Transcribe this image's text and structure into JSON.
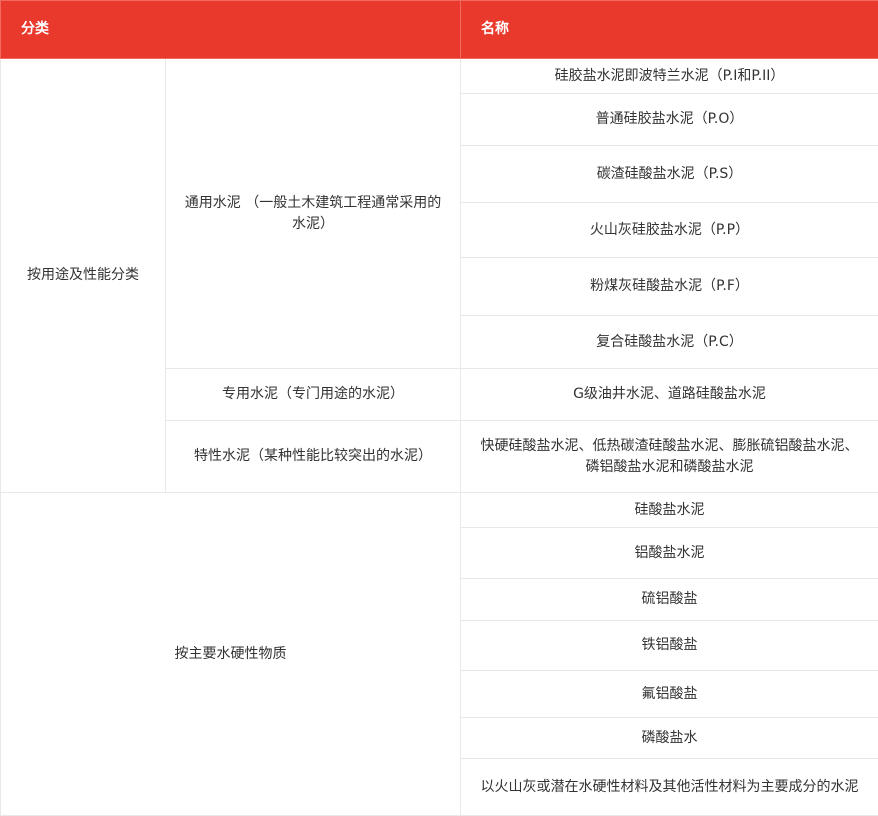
{
  "header": {
    "col1": "分类",
    "col2": "名称"
  },
  "group1": {
    "label": "按用途及性能分类",
    "subgroups": [
      {
        "label": "通用水泥 （一般土木建筑工程通常采用的水泥）",
        "items": [
          "硅胶盐水泥即波特兰水泥（P.I和P.II）",
          "普通硅胶盐水泥（P.O）",
          "碳渣硅酸盐水泥（P.S）",
          "火山灰硅胶盐水泥（P.P）",
          "粉煤灰硅酸盐水泥（P.F）",
          "复合硅酸盐水泥（P.C）"
        ]
      },
      {
        "label": "专用水泥（专门用途的水泥）",
        "items": [
          "G级油井水泥、道路硅酸盐水泥"
        ]
      },
      {
        "label": "特性水泥（某种性能比较突出的水泥）",
        "items": [
          "快硬硅酸盐水泥、低热碳渣硅酸盐水泥、膨胀硫铝酸盐水泥、磷铝酸盐水泥和磷酸盐水泥"
        ]
      }
    ]
  },
  "group2": {
    "label": "按主要水硬性物质",
    "items": [
      "硅酸盐水泥",
      "铝酸盐水泥",
      "硫铝酸盐",
      "铁铝酸盐",
      "氟铝酸盐",
      "磷酸盐水",
      "以火山灰或潜在水硬性材料及其他活性材料为主要成分的水泥"
    ]
  }
}
